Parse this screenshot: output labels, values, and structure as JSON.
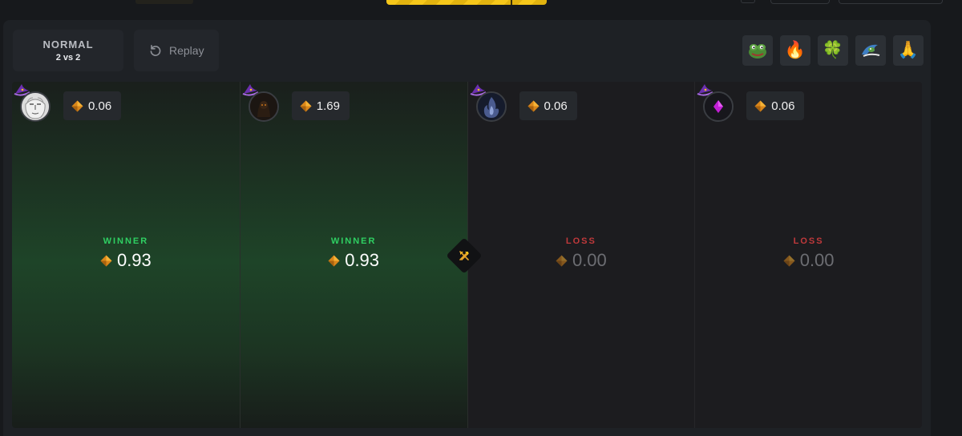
{
  "mode": {
    "title": "NORMAL",
    "subtitle": "2 vs 2"
  },
  "replay": {
    "label": "Replay"
  },
  "emotes": [
    "pepe-frog-icon",
    "fire-icon",
    "clover-icon",
    "surfing-frog-icon",
    "praying-hands-icon"
  ],
  "players": [
    {
      "avatar": "statue-face-icon",
      "stake": "0.06",
      "result_label": "WINNER",
      "result_amount": "0.93",
      "outcome": "win"
    },
    {
      "avatar": "dark-figure-icon",
      "stake": "1.69",
      "result_label": "WINNER",
      "result_amount": "0.93",
      "outcome": "win"
    },
    {
      "avatar": "blue-flame-icon",
      "stake": "0.06",
      "result_label": "LOSS",
      "result_amount": "0.00",
      "outcome": "loss"
    },
    {
      "avatar": "purple-gem-icon",
      "stake": "0.06",
      "result_label": "LOSS",
      "result_amount": "0.00",
      "outcome": "loss"
    }
  ],
  "colors": {
    "winner": "#2fcf62",
    "loss": "#c0393b",
    "accent": "#f6c71a",
    "gem": "#f0a020"
  }
}
